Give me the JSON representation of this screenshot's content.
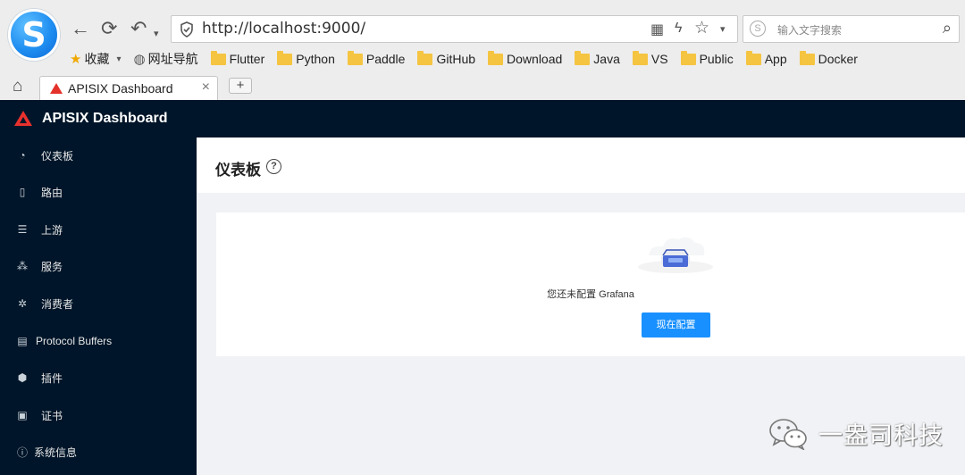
{
  "browser": {
    "url": "http://localhost:9000/",
    "search_placeholder": "输入文字搜索",
    "bookmarks": {
      "favorites": "收藏",
      "web_nav": "网址导航",
      "folders": [
        "Flutter",
        "Python",
        "Paddle",
        "GitHub",
        "Download",
        "Java",
        "VS",
        "Public",
        "App",
        "Docker"
      ]
    },
    "tab": {
      "title": "APISIX Dashboard"
    },
    "new_tab_label": "+"
  },
  "app": {
    "title": "APISIX Dashboard",
    "accent_color": "#1890ff",
    "sidebar_color": "#001529",
    "sidebar": {
      "items": [
        {
          "label": "仪表板",
          "icon": "dashboard-icon"
        },
        {
          "label": "路由",
          "icon": "route-icon"
        },
        {
          "label": "上游",
          "icon": "upstream-icon"
        },
        {
          "label": "服务",
          "icon": "service-icon"
        },
        {
          "label": "消费者",
          "icon": "consumer-icon"
        },
        {
          "label": "Protocol Buffers",
          "icon": "file-icon"
        },
        {
          "label": "插件",
          "icon": "plugin-icon"
        },
        {
          "label": "证书",
          "icon": "certificate-icon"
        },
        {
          "label": "系统信息",
          "icon": "info-icon"
        }
      ]
    },
    "page": {
      "title": "仪表板",
      "empty_message": "您还未配置 Grafana",
      "configure_button": "现在配置"
    }
  },
  "watermark": {
    "text": "一盎司科技"
  }
}
